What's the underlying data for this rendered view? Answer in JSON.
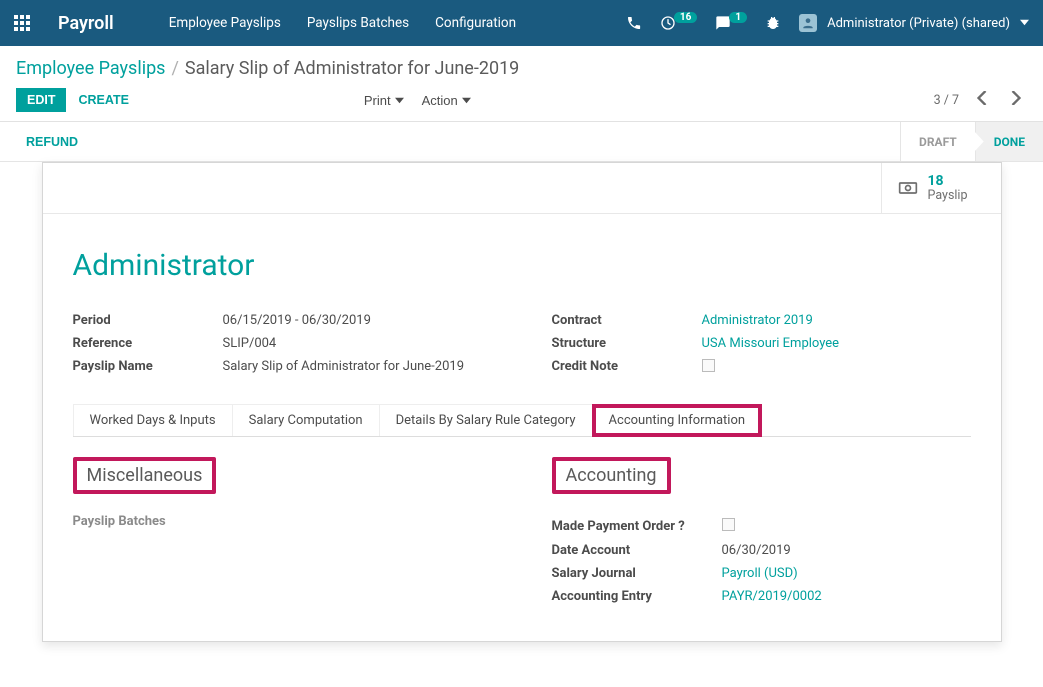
{
  "navbar": {
    "app_name": "Payroll",
    "menu": [
      "Employee Payslips",
      "Payslips Batches",
      "Configuration"
    ],
    "activities_count": "16",
    "messages_count": "1",
    "user_label": "Administrator (Private) (shared)"
  },
  "breadcrumb": {
    "parent": "Employee Payslips",
    "current": "Salary Slip of Administrator for June-2019"
  },
  "buttons": {
    "edit": "EDIT",
    "create": "CREATE",
    "print": "Print",
    "action": "Action",
    "refund": "REFUND"
  },
  "pager": {
    "text": "3 / 7"
  },
  "status": {
    "draft": "DRAFT",
    "done": "DONE"
  },
  "stat": {
    "value": "18",
    "label": "Payslip"
  },
  "record_title": "Administrator",
  "left_fields": {
    "period_label": "Period",
    "period_val": "06/15/2019 - 06/30/2019",
    "reference_label": "Reference",
    "reference_val": "SLIP/004",
    "name_label": "Payslip Name",
    "name_val": "Salary Slip of Administrator for June-2019"
  },
  "right_fields": {
    "contract_label": "Contract",
    "contract_val": "Administrator 2019",
    "structure_label": "Structure",
    "structure_val": "USA Missouri Employee",
    "credit_label": "Credit Note"
  },
  "tabs": {
    "t1": "Worked Days & Inputs",
    "t2": "Salary Computation",
    "t3": "Details By Salary Rule Category",
    "t4": "Accounting Information"
  },
  "sections": {
    "misc_title": "Miscellaneous",
    "payslip_batches_label": "Payslip Batches",
    "acc_title": "Accounting",
    "made_payment_label": "Made Payment Order ?",
    "date_account_label": "Date Account",
    "date_account_val": "06/30/2019",
    "salary_journal_label": "Salary Journal",
    "salary_journal_val": "Payroll (USD)",
    "acc_entry_label": "Accounting Entry",
    "acc_entry_val": "PAYR/2019/0002"
  }
}
